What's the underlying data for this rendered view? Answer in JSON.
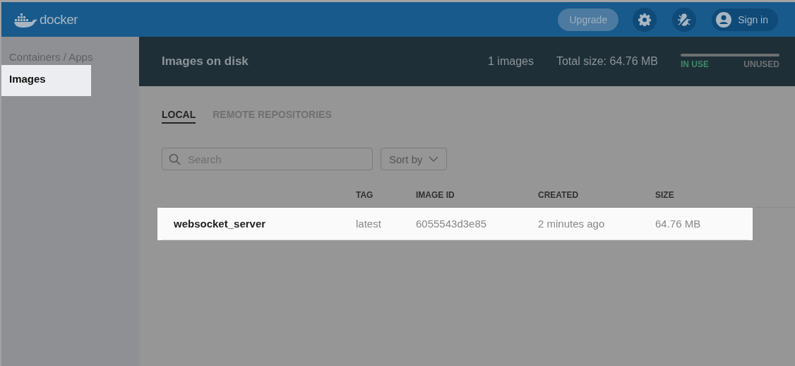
{
  "topbar": {
    "logo_text": "docker",
    "upgrade": "Upgrade",
    "sign_in": "Sign in"
  },
  "sidebar": {
    "items": [
      {
        "label": "Containers / Apps",
        "selected": false
      },
      {
        "label": "Images",
        "selected": true
      }
    ]
  },
  "header": {
    "title": "Images on disk",
    "count": "1 images",
    "total_size": "Total size: 64.76 MB",
    "in_use": "IN USE",
    "unused": "UNUSED"
  },
  "tabs": [
    {
      "label": "LOCAL",
      "selected": true
    },
    {
      "label": "REMOTE REPOSITORIES",
      "selected": false
    }
  ],
  "search": {
    "placeholder": "Search"
  },
  "sort": {
    "label": "Sort by"
  },
  "table": {
    "columns": [
      "TAG",
      "IMAGE ID",
      "CREATED",
      "SIZE"
    ],
    "rows": [
      {
        "name": "websocket_server",
        "tag": "latest",
        "image_id": "6055543d3e85",
        "created": "2 minutes ago",
        "size": "64.76 MB",
        "highlighted": true
      }
    ]
  }
}
